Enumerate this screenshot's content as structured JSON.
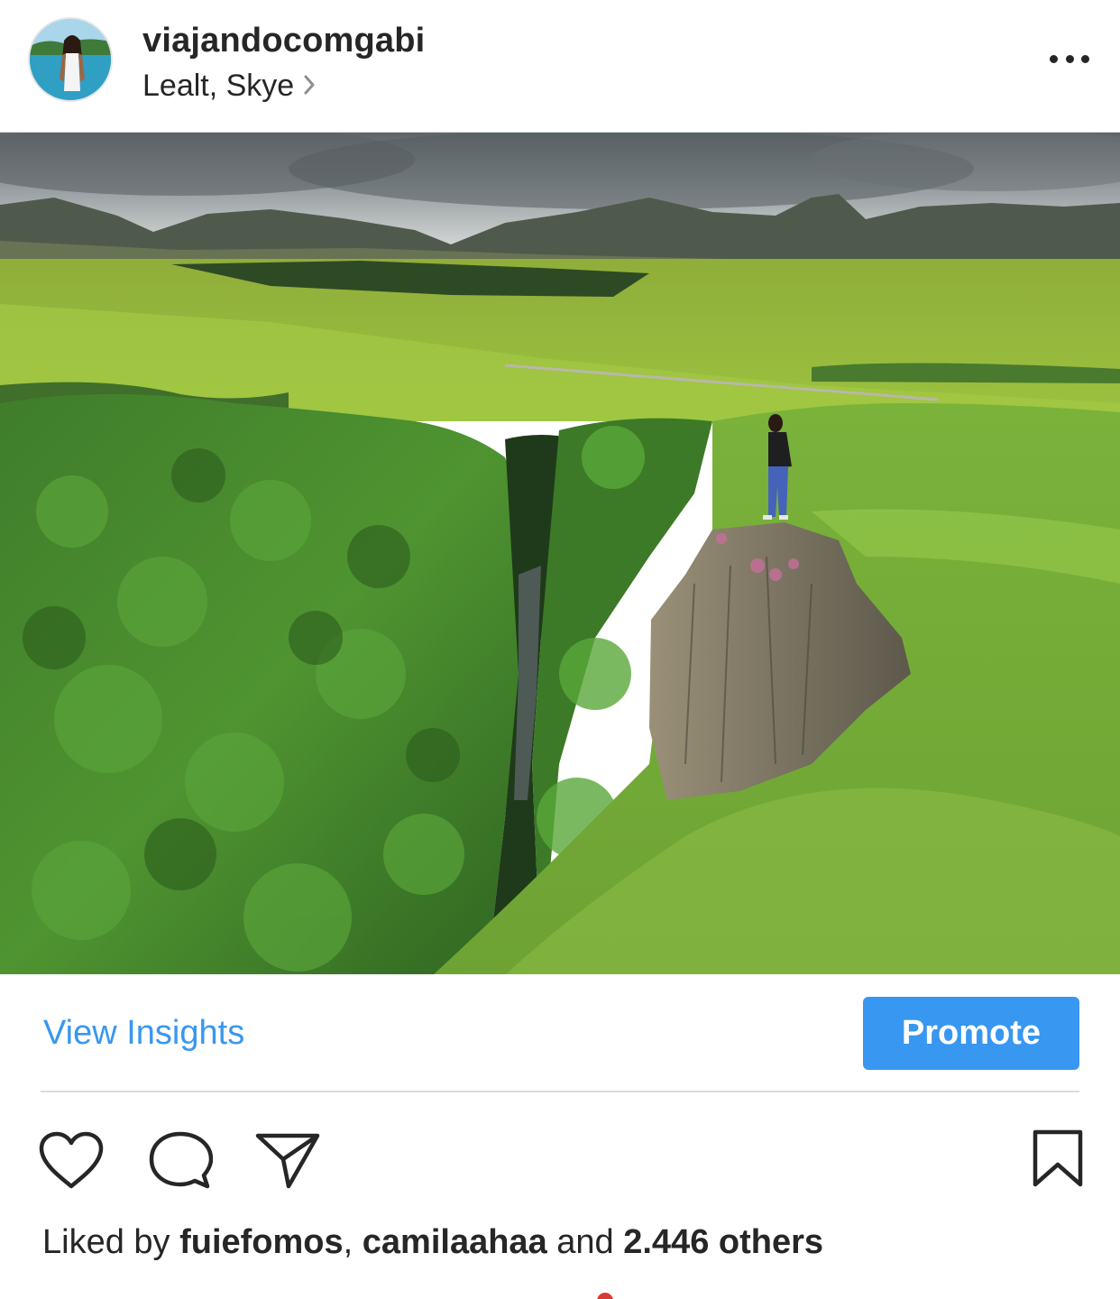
{
  "header": {
    "username": "viajandocomgabi",
    "location": "Lealt, Skye",
    "more_icon": "more-horizontal-icon",
    "chevron_icon": "chevron-right-icon"
  },
  "insights": {
    "view_insights_label": "View Insights",
    "promote_label": "Promote"
  },
  "actions": {
    "like_icon": "heart-icon",
    "comment_icon": "comment-icon",
    "share_icon": "paper-plane-icon",
    "save_icon": "bookmark-icon"
  },
  "likes": {
    "prefix": "Liked by ",
    "user1": "fuiefomos",
    "separator": ", ",
    "user2": "camilaahaa",
    "and_text": " and ",
    "others": "2.446 others"
  },
  "colors": {
    "accent": "#3897f0",
    "text": "#262626",
    "divider": "#dbdbdb"
  }
}
